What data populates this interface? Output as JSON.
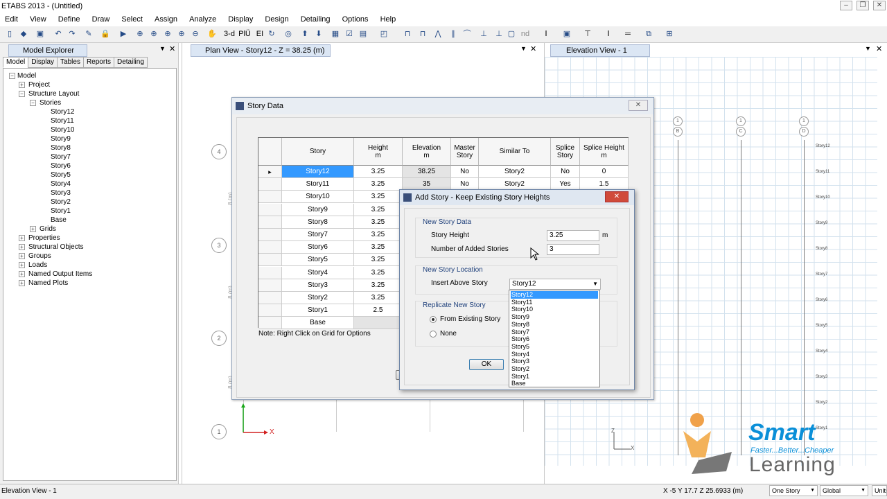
{
  "app": {
    "title": "ETABS 2013  - (Untitled)"
  },
  "menu": [
    "Edit",
    "View",
    "Define",
    "Draw",
    "Select",
    "Assign",
    "Analyze",
    "Display",
    "Design",
    "Detailing",
    "Options",
    "Help"
  ],
  "toolbar": {
    "three_d": "3-d",
    "pl_label": "PlÜ",
    "el_label": "EI"
  },
  "explorer": {
    "title": "Model Explorer",
    "tabs": [
      "Model",
      "Display",
      "Tables",
      "Reports",
      "Detailing"
    ],
    "tree": {
      "root": "Model",
      "project": "Project",
      "structure_layout": "Structure Layout",
      "stories": "Stories",
      "story_items": [
        "Story12",
        "Story11",
        "Story10",
        "Story9",
        "Story8",
        "Story7",
        "Story6",
        "Story5",
        "Story4",
        "Story3",
        "Story2",
        "Story1",
        "Base"
      ],
      "grids": "Grids",
      "others": [
        "Properties",
        "Structural Objects",
        "Groups",
        "Loads",
        "Named Output Items",
        "Named Plots"
      ]
    }
  },
  "plan_view": {
    "title": "Plan View - Story12 - Z = 38.25 (m)",
    "bubbles": [
      "4",
      "3",
      "2",
      "1"
    ],
    "dim_label": "8 (m)",
    "axis_x": "X"
  },
  "elev_view": {
    "title": "Elevation View - 1",
    "bubbles_top": [
      "1",
      "B"
    ],
    "bubbles_mid": [
      "1",
      "C"
    ],
    "bubbles_right": [
      "1",
      "D"
    ],
    "story_labels": [
      "Story12",
      "Story11",
      "Story10",
      "Story9",
      "Story8",
      "Story7",
      "Story6",
      "Story5",
      "Story4",
      "Story3",
      "Story2",
      "Story1"
    ],
    "axis_x": "X",
    "axis_z": "Z"
  },
  "story_dialog": {
    "title": "Story Data",
    "headers": {
      "story": "Story",
      "height": "Height",
      "height_unit": "m",
      "elevation": "Elevation",
      "elevation_unit": "m",
      "master1": "Master",
      "master2": "Story",
      "similar": "Similar To",
      "splice1": "Splice",
      "splice2": "Story",
      "splice_h": "Splice Height",
      "splice_h_unit": "m"
    },
    "rows": [
      {
        "story": "Story12",
        "height": "3.25",
        "elevation": "38.25",
        "master": "No",
        "similar": "Story2",
        "splice": "No",
        "splice_h": "0"
      },
      {
        "story": "Story11",
        "height": "3.25",
        "elevation": "35",
        "master": "No",
        "similar": "Story2",
        "splice": "Yes",
        "splice_h": "1.5"
      },
      {
        "story": "Story10",
        "height": "3.25"
      },
      {
        "story": "Story9",
        "height": "3.25"
      },
      {
        "story": "Story8",
        "height": "3.25"
      },
      {
        "story": "Story7",
        "height": "3.25"
      },
      {
        "story": "Story6",
        "height": "3.25"
      },
      {
        "story": "Story5",
        "height": "3.25"
      },
      {
        "story": "Story4",
        "height": "3.25"
      },
      {
        "story": "Story3",
        "height": "3.25"
      },
      {
        "story": "Story2",
        "height": "3.25"
      },
      {
        "story": "Story1",
        "height": "2.5"
      },
      {
        "story": "Base",
        "height": ""
      }
    ],
    "note": "Note:  Right Click on Grid for Options"
  },
  "add_dialog": {
    "title": "Add Story - Keep Existing Story Heights",
    "new_data_label": "New Story Data",
    "story_height_label": "Story Height",
    "story_height_value": "3.25",
    "unit": "m",
    "num_added_label": "Number of Added Stories",
    "num_added_value": "3",
    "location_label": "New Story Location",
    "insert_above_label": "Insert Above Story",
    "insert_above_value": "Story12",
    "replicate_label": "Replicate New Story",
    "from_existing": "From Existing Story",
    "none": "None",
    "ok": "OK",
    "dropdown_options": [
      "Story12",
      "Story11",
      "Story10",
      "Story9",
      "Story8",
      "Story7",
      "Story6",
      "Story5",
      "Story4",
      "Story3",
      "Story2",
      "Story1",
      "Base"
    ]
  },
  "status": {
    "left": "Elevation View - 1",
    "coords": "X -5  Y 17.7  Z 25.6933 (m)",
    "story_select": "One Story",
    "coord_select": "Global",
    "units": "Units"
  },
  "watermark": {
    "line1": "Smart",
    "line2": "Faster...Better...Cheaper",
    "line3": "Learning"
  },
  "colors": {
    "accent": "#3399ff",
    "grid_line": "#c9dcea",
    "axis_green": "#1aa81a",
    "axis_red": "#d22020",
    "brand_blue": "#0a8fd8",
    "brand_gray": "#666666"
  }
}
